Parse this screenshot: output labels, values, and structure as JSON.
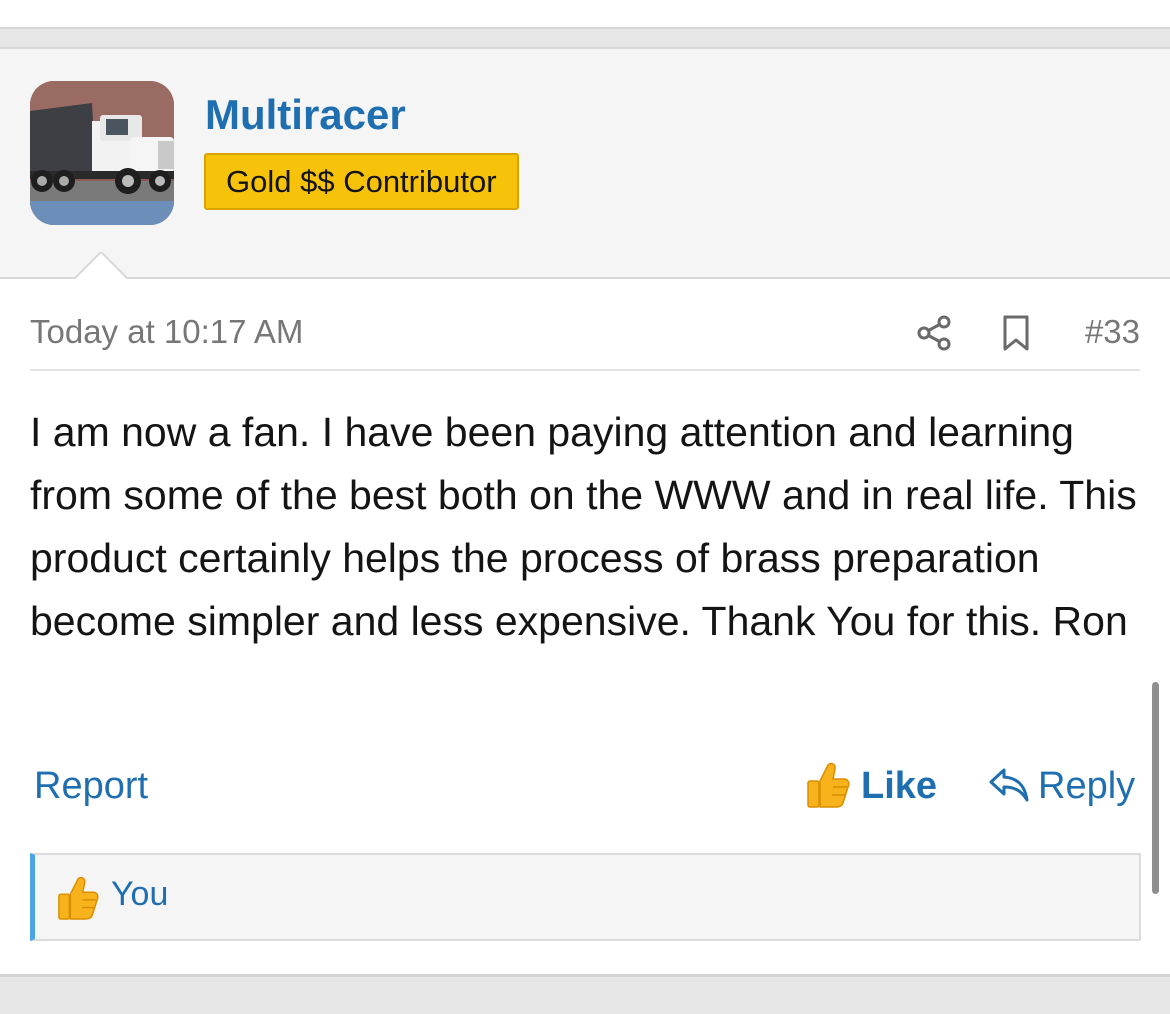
{
  "post": {
    "username": "Multiracer",
    "user_title": "Gold $$ Contributor",
    "timestamp": "Today at 10:17 AM",
    "post_number": "#33",
    "body": "I am now a fan. I have been paying attention and learning from some of the best both on the WWW and in real life. This product certainly helps the process of brass preparation become simpler and less expensive. Thank You for this. Ron",
    "actions": {
      "report_label": "Report",
      "like_label": "Like",
      "reply_label": "Reply"
    },
    "reactions": {
      "by": "You"
    }
  },
  "icons": {
    "share": "share-icon",
    "bookmark": "bookmark-icon",
    "like": "thumbs-up-icon",
    "reply": "reply-icon"
  },
  "colors": {
    "link": "#1f6fb0",
    "badge": "#f6c20a",
    "reaction_accent": "#4aa4e8"
  }
}
